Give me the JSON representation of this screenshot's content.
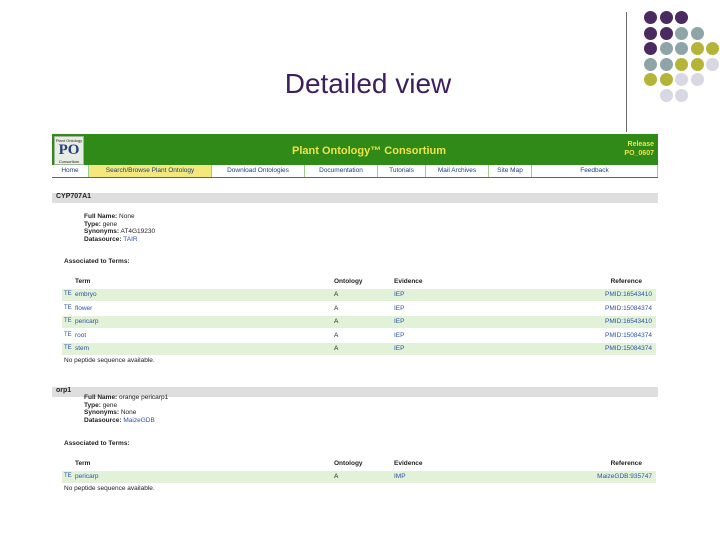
{
  "slide": {
    "title": "Detailed view"
  },
  "decoration": {
    "dots": [
      {
        "r": 0,
        "c": 0,
        "color": "#4b2a5f"
      },
      {
        "r": 0,
        "c": 1,
        "color": "#4b2a5f"
      },
      {
        "r": 0,
        "c": 2,
        "color": "#4b2a5f"
      },
      {
        "r": 1,
        "c": 0,
        "color": "#4b2a5f"
      },
      {
        "r": 1,
        "c": 1,
        "color": "#4b2a5f"
      },
      {
        "r": 1,
        "c": 2,
        "color": "#8fa4a6"
      },
      {
        "r": 1,
        "c": 3,
        "color": "#8fa4a6"
      },
      {
        "r": 2,
        "c": 0,
        "color": "#4b2a5f"
      },
      {
        "r": 2,
        "c": 1,
        "color": "#8fa4a6"
      },
      {
        "r": 2,
        "c": 2,
        "color": "#8fa4a6"
      },
      {
        "r": 2,
        "c": 3,
        "color": "#b4b538"
      },
      {
        "r": 2,
        "c": 4,
        "color": "#b4b538"
      },
      {
        "r": 3,
        "c": 0,
        "color": "#8fa4a6"
      },
      {
        "r": 3,
        "c": 1,
        "color": "#8fa4a6"
      },
      {
        "r": 3,
        "c": 2,
        "color": "#b4b538"
      },
      {
        "r": 3,
        "c": 3,
        "color": "#b4b538"
      },
      {
        "r": 3,
        "c": 4,
        "color": "#d8d8e2"
      },
      {
        "r": 4,
        "c": 0,
        "color": "#b4b538"
      },
      {
        "r": 4,
        "c": 1,
        "color": "#b4b538"
      },
      {
        "r": 4,
        "c": 2,
        "color": "#d8d8e2"
      },
      {
        "r": 4,
        "c": 3,
        "color": "#d8d8e2"
      },
      {
        "r": 5,
        "c": 1,
        "color": "#d8d8e2"
      },
      {
        "r": 5,
        "c": 2,
        "color": "#d8d8e2"
      }
    ]
  },
  "site": {
    "logo": {
      "top": "Plant Ontology",
      "mark": "PO",
      "bottom": "Consortium"
    },
    "title": "Plant Ontology™ Consortium",
    "release_label": "Release",
    "release_value": "PO_0607",
    "nav": [
      {
        "label": "Home",
        "active": false
      },
      {
        "label": "Search/Browse Plant Ontology",
        "active": true
      },
      {
        "label": "Download Ontologies",
        "active": false
      },
      {
        "label": "Documentation",
        "active": false
      },
      {
        "label": "Tutorials",
        "active": false
      },
      {
        "label": "Mail Archives",
        "active": false
      },
      {
        "label": "Site Map",
        "active": false
      },
      {
        "label": "Feedback",
        "active": false
      }
    ]
  },
  "columns": {
    "term": "Term",
    "ontology": "Ontology",
    "evidence": "Evidence",
    "reference": "Reference"
  },
  "labels": {
    "full_name": "Full Name:",
    "type": "Type:",
    "synonyms": "Synonyms:",
    "datasource": "Datasource:",
    "associated": "Associated to Terms:",
    "no_peptide": "No peptide sequence available.",
    "term_icon": "TE"
  },
  "genes": [
    {
      "name": "CYP707A1",
      "full_name": "None",
      "type": "gene",
      "synonyms": "AT4G19230",
      "datasource": "TAIR",
      "rows": [
        {
          "term": "embryo",
          "ontology": "A",
          "evidence": "IEP",
          "reference": "PMID:16543410"
        },
        {
          "term": "flower",
          "ontology": "A",
          "evidence": "IEP",
          "reference": "PMID:15084374"
        },
        {
          "term": "pericarp",
          "ontology": "A",
          "evidence": "IEP",
          "reference": "PMID:16543410"
        },
        {
          "term": "root",
          "ontology": "A",
          "evidence": "IEP",
          "reference": "PMID:15084374"
        },
        {
          "term": "stem",
          "ontology": "A",
          "evidence": "IEP",
          "reference": "PMID:15084374"
        }
      ]
    },
    {
      "name": "orp1",
      "full_name": "orange pericarp1",
      "type": "gene",
      "synonyms": "None",
      "datasource": "MaizeGDB",
      "rows": [
        {
          "term": "pericarp",
          "ontology": "A",
          "evidence": "IMP",
          "reference": "MaizeGDB:935747"
        }
      ]
    }
  ]
}
